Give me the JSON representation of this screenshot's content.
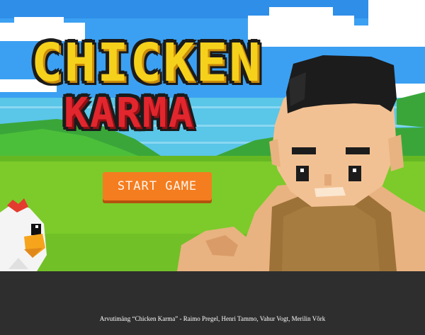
{
  "game": {
    "title_line1": "CHICKEN",
    "title_line2": "KARMA",
    "start_label": "START GAME"
  },
  "footer": {
    "credits": "Arvutimäng “Chicken Karma” - Raimo Pregel, Henri Tammo, Vahur Vogt, Merilin Võrk"
  },
  "colors": {
    "title_yellow": "#f6d11c",
    "title_red": "#e2262e",
    "button_orange": "#f47d20",
    "sky": "#3ba0f2",
    "grass": "#7ccb2a",
    "footer_bg": "#2e2e2e"
  },
  "icons": [
    "chicken-icon",
    "caveman-character"
  ]
}
